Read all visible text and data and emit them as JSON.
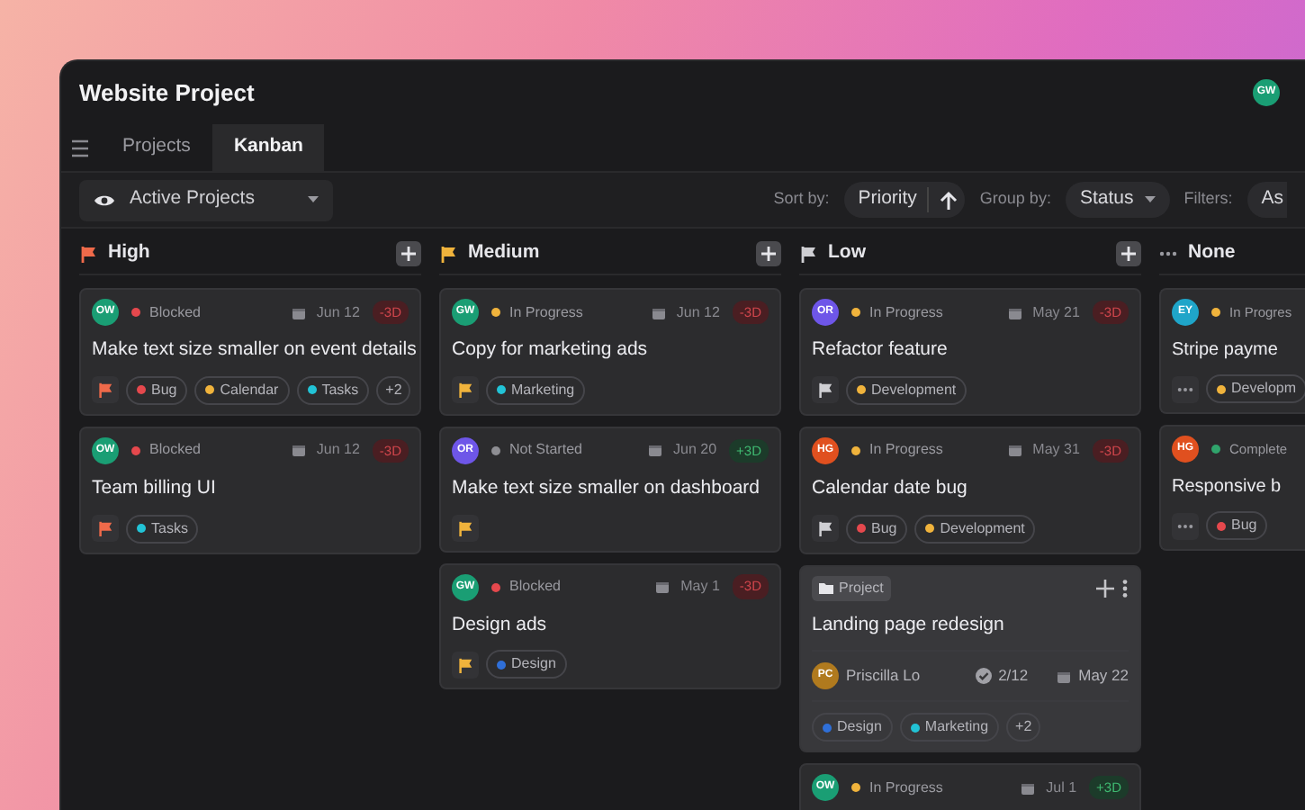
{
  "window": {
    "title": "Website Project",
    "user_avatar": {
      "initials": "GW",
      "color": "#1a9e74"
    }
  },
  "tabs": [
    {
      "label": "Projects",
      "selected": false
    },
    {
      "label": "Kanban",
      "selected": true
    }
  ],
  "toolbar": {
    "view": "Active Projects",
    "sort_label": "Sort by:",
    "sort_value": "Priority",
    "group_label": "Group by:",
    "group_value": "Status",
    "filters_label": "Filters:",
    "filters_value": "As"
  },
  "columns": [
    {
      "title": "High",
      "kind": "high",
      "add": true,
      "cards": [
        {
          "kind": "task",
          "avatar": {
            "initials": "OW",
            "color": "#1a9e74"
          },
          "status": {
            "label": "Blocked",
            "color": "#e5484d"
          },
          "date": "Jun 12",
          "delta": "-3D",
          "overdue": true,
          "title": "Make text size smaller on event details",
          "tags": [
            {
              "label": "Bug",
              "color": "#e5484d"
            },
            {
              "label": "Calendar",
              "color": "#f0b33c"
            },
            {
              "label": "Tasks",
              "color": "#22c3d6"
            }
          ],
          "more": "+2"
        },
        {
          "kind": "task",
          "avatar": {
            "initials": "OW",
            "color": "#1a9e74"
          },
          "status": {
            "label": "Blocked",
            "color": "#e5484d"
          },
          "date": "Jun 12",
          "delta": "-3D",
          "overdue": true,
          "title": "Team billing UI",
          "tags": [
            {
              "label": "Tasks",
              "color": "#22c3d6"
            }
          ]
        }
      ]
    },
    {
      "title": "Medium",
      "kind": "medium",
      "add": true,
      "cards": [
        {
          "kind": "task",
          "avatar": {
            "initials": "GW",
            "color": "#1a9e74"
          },
          "status": {
            "label": "In Progress",
            "color": "#f0b33c"
          },
          "date": "Jun 12",
          "delta": "-3D",
          "overdue": true,
          "title": "Copy for marketing ads",
          "tags": [
            {
              "label": "Marketing",
              "color": "#22c3d6"
            }
          ]
        },
        {
          "kind": "task",
          "avatar": {
            "initials": "OR",
            "color": "#6e56e8"
          },
          "status": {
            "label": "Not Started",
            "color": "#8e8e93"
          },
          "date": "Jun 20",
          "delta": "+3D",
          "overdue": false,
          "title": "Make text size smaller on dashboard"
        },
        {
          "kind": "task",
          "avatar": {
            "initials": "GW",
            "color": "#1a9e74"
          },
          "status": {
            "label": "Blocked",
            "color": "#e5484d"
          },
          "date": "May 1",
          "delta": "-3D",
          "overdue": true,
          "title": "Design ads",
          "tags": [
            {
              "label": "Design",
              "color": "#2f6fd8"
            }
          ]
        }
      ]
    },
    {
      "title": "Low",
      "kind": "low",
      "add": true,
      "cards": [
        {
          "kind": "task",
          "avatar": {
            "initials": "OR",
            "color": "#6e56e8"
          },
          "status": {
            "label": "In Progress",
            "color": "#f0b33c"
          },
          "date": "May 21",
          "delta": "-3D",
          "overdue": true,
          "title": "Refactor feature",
          "tags": [
            {
              "label": "Development",
              "color": "#f0b33c"
            }
          ]
        },
        {
          "kind": "task",
          "avatar": {
            "initials": "HG",
            "color": "#e0501f"
          },
          "status": {
            "label": "In Progress",
            "color": "#f0b33c"
          },
          "date": "May 31",
          "delta": "-3D",
          "overdue": true,
          "title": "Calendar date bug",
          "tags": [
            {
              "label": "Bug",
              "color": "#e5484d"
            },
            {
              "label": "Development",
              "color": "#f0b33c"
            }
          ]
        },
        {
          "kind": "project",
          "badge": "Project",
          "title": "Landing page redesign",
          "owner": {
            "initials": "PC",
            "color": "#b07a1e",
            "name": "Priscilla Lo"
          },
          "subtasks": "2/12",
          "date": "May 22",
          "tags": [
            {
              "label": "Design",
              "color": "#2f6fd8"
            },
            {
              "label": "Marketing",
              "color": "#22c3d6"
            }
          ],
          "more": "+2"
        },
        {
          "kind": "task",
          "avatar": {
            "initials": "OW",
            "color": "#1a9e74"
          },
          "status": {
            "label": "In Progress",
            "color": "#f0b33c"
          },
          "date": "Jul 1",
          "delta": "+3D",
          "overdue": false
        }
      ]
    },
    {
      "title": "None",
      "kind": "none",
      "add": false,
      "cards": [
        {
          "kind": "task",
          "avatar": {
            "initials": "EY",
            "color": "#1fa5c9"
          },
          "status": {
            "label": "In Progres",
            "color": "#f0b33c"
          },
          "title": "Stripe payme",
          "tags": [
            {
              "label": "Developm",
              "color": "#f0b33c"
            }
          ]
        },
        {
          "kind": "task",
          "avatar": {
            "initials": "HG",
            "color": "#e0501f"
          },
          "status": {
            "label": "Complete",
            "color": "#30a46c"
          },
          "title": "Responsive b",
          "tags": [
            {
              "label": "Bug",
              "color": "#e5484d"
            }
          ]
        }
      ]
    }
  ]
}
